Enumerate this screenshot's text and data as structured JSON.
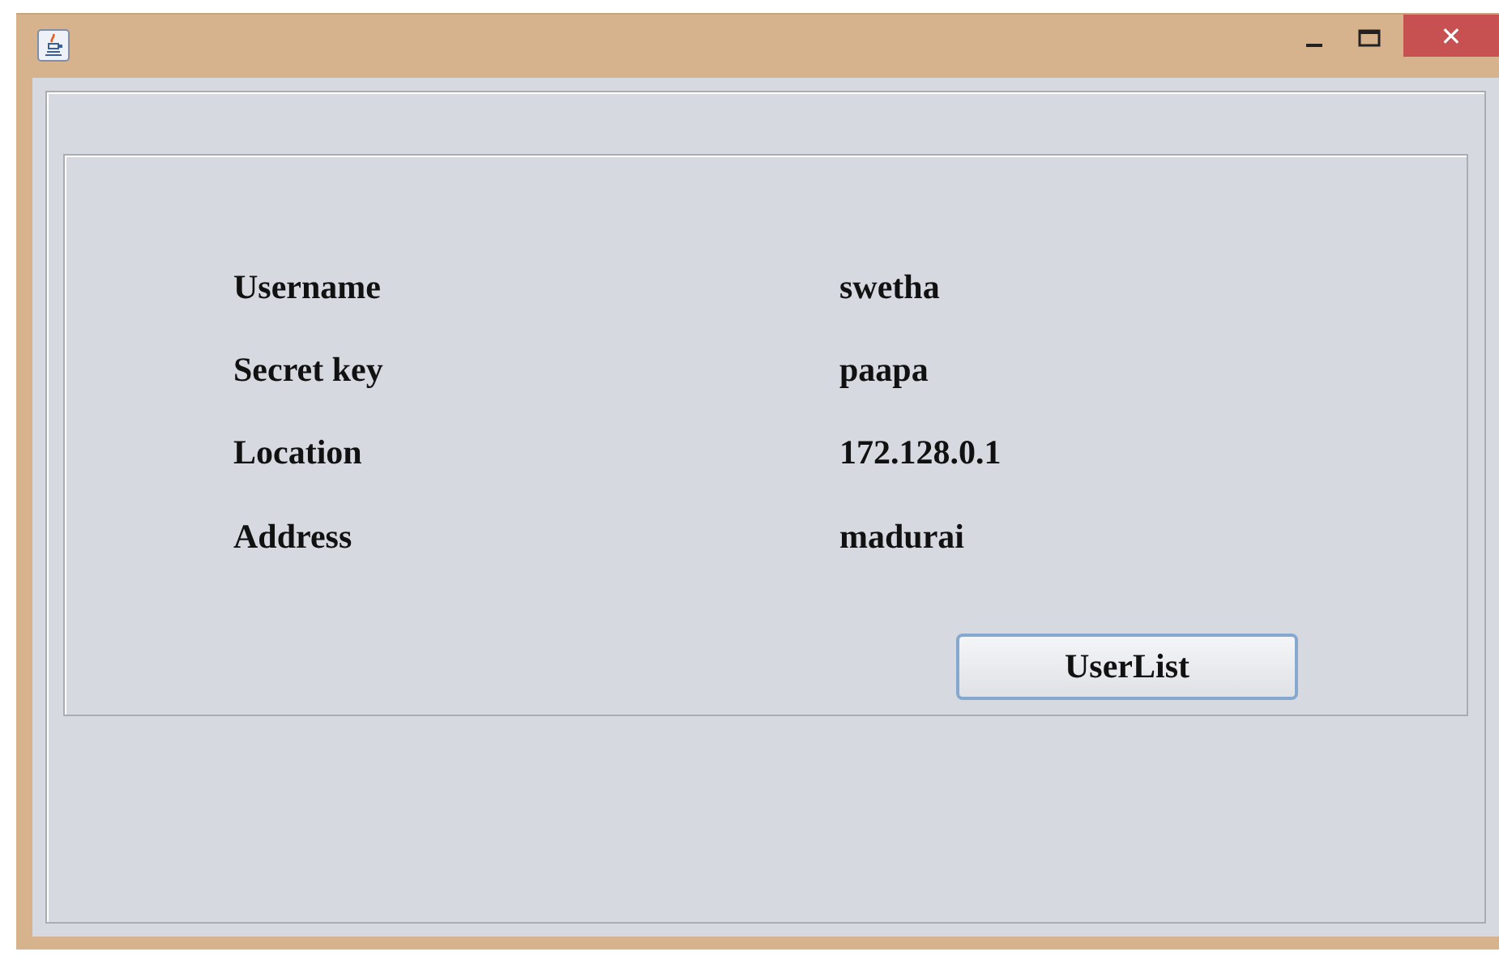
{
  "window": {
    "close_symbol": "✕"
  },
  "fields": [
    {
      "label": "Username",
      "value": "swetha"
    },
    {
      "label": "Secret key",
      "value": "paapa"
    },
    {
      "label": "Location",
      "value": "172.128.0.1"
    },
    {
      "label": "Address",
      "value": "madurai"
    }
  ],
  "button": "UserList"
}
